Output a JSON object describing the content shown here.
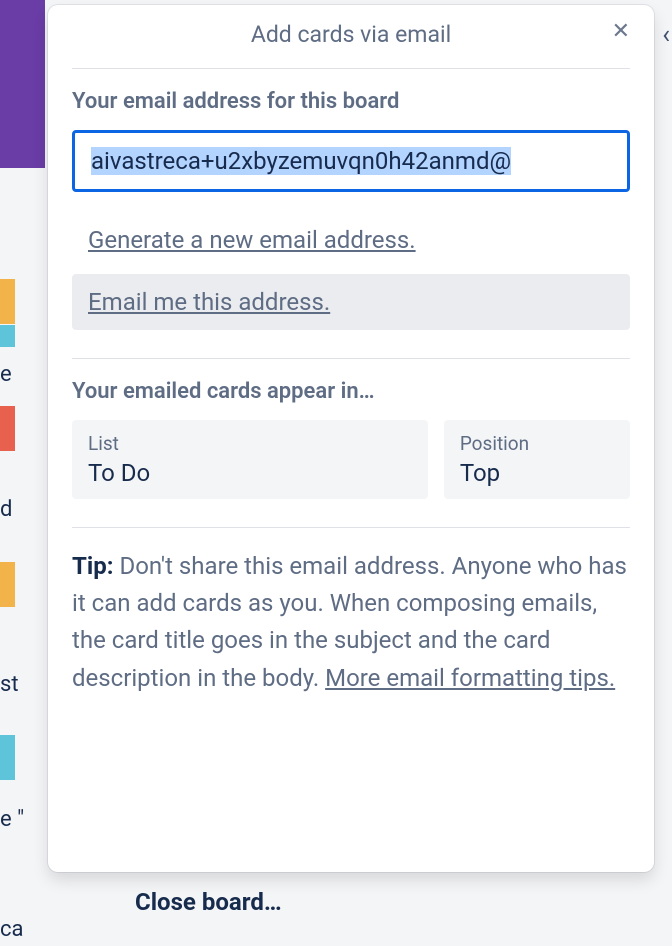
{
  "panel": {
    "title": "Add cards via email",
    "email_label": "Your email address for this board",
    "email_value": "aivastreca+u2xbyzemuvqn0h42anmd@",
    "generate_link": "Generate a new email address.",
    "email_me_link": "Email me this address.",
    "appear_label": "Your emailed cards appear in…",
    "list": {
      "label": "List",
      "value": "To Do"
    },
    "position": {
      "label": "Position",
      "value": "Top"
    },
    "tip_bold": "Tip:",
    "tip_body": " Don't share this email address. Anyone who has it can add cards as you. When composing emails, the card title goes in the subject and the card description in the body. ",
    "tip_link": "More email formatting tips."
  },
  "behind": {
    "close_board": "Close board…",
    "frag_ie": "e",
    "frag_di": "d",
    "frag_sto": "st",
    "frag_e": "e \"",
    "frag_ca": "ca"
  }
}
